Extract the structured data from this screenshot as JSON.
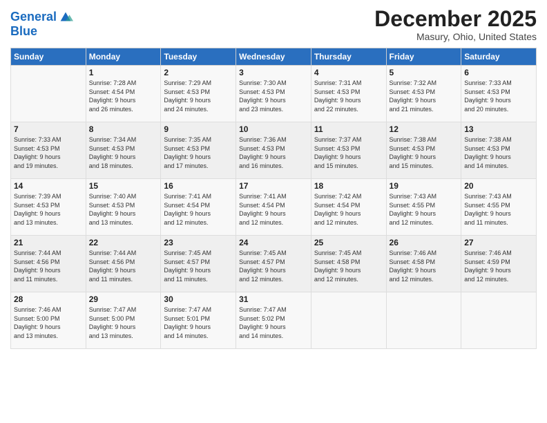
{
  "header": {
    "logo_line1": "General",
    "logo_line2": "Blue",
    "month_year": "December 2025",
    "location": "Masury, Ohio, United States"
  },
  "days_of_week": [
    "Sunday",
    "Monday",
    "Tuesday",
    "Wednesday",
    "Thursday",
    "Friday",
    "Saturday"
  ],
  "weeks": [
    [
      {
        "day": "",
        "info": ""
      },
      {
        "day": "1",
        "info": "Sunrise: 7:28 AM\nSunset: 4:54 PM\nDaylight: 9 hours\nand 26 minutes."
      },
      {
        "day": "2",
        "info": "Sunrise: 7:29 AM\nSunset: 4:53 PM\nDaylight: 9 hours\nand 24 minutes."
      },
      {
        "day": "3",
        "info": "Sunrise: 7:30 AM\nSunset: 4:53 PM\nDaylight: 9 hours\nand 23 minutes."
      },
      {
        "day": "4",
        "info": "Sunrise: 7:31 AM\nSunset: 4:53 PM\nDaylight: 9 hours\nand 22 minutes."
      },
      {
        "day": "5",
        "info": "Sunrise: 7:32 AM\nSunset: 4:53 PM\nDaylight: 9 hours\nand 21 minutes."
      },
      {
        "day": "6",
        "info": "Sunrise: 7:33 AM\nSunset: 4:53 PM\nDaylight: 9 hours\nand 20 minutes."
      }
    ],
    [
      {
        "day": "7",
        "info": "Sunrise: 7:33 AM\nSunset: 4:53 PM\nDaylight: 9 hours\nand 19 minutes."
      },
      {
        "day": "8",
        "info": "Sunrise: 7:34 AM\nSunset: 4:53 PM\nDaylight: 9 hours\nand 18 minutes."
      },
      {
        "day": "9",
        "info": "Sunrise: 7:35 AM\nSunset: 4:53 PM\nDaylight: 9 hours\nand 17 minutes."
      },
      {
        "day": "10",
        "info": "Sunrise: 7:36 AM\nSunset: 4:53 PM\nDaylight: 9 hours\nand 16 minutes."
      },
      {
        "day": "11",
        "info": "Sunrise: 7:37 AM\nSunset: 4:53 PM\nDaylight: 9 hours\nand 15 minutes."
      },
      {
        "day": "12",
        "info": "Sunrise: 7:38 AM\nSunset: 4:53 PM\nDaylight: 9 hours\nand 15 minutes."
      },
      {
        "day": "13",
        "info": "Sunrise: 7:38 AM\nSunset: 4:53 PM\nDaylight: 9 hours\nand 14 minutes."
      }
    ],
    [
      {
        "day": "14",
        "info": "Sunrise: 7:39 AM\nSunset: 4:53 PM\nDaylight: 9 hours\nand 13 minutes."
      },
      {
        "day": "15",
        "info": "Sunrise: 7:40 AM\nSunset: 4:53 PM\nDaylight: 9 hours\nand 13 minutes."
      },
      {
        "day": "16",
        "info": "Sunrise: 7:41 AM\nSunset: 4:54 PM\nDaylight: 9 hours\nand 12 minutes."
      },
      {
        "day": "17",
        "info": "Sunrise: 7:41 AM\nSunset: 4:54 PM\nDaylight: 9 hours\nand 12 minutes."
      },
      {
        "day": "18",
        "info": "Sunrise: 7:42 AM\nSunset: 4:54 PM\nDaylight: 9 hours\nand 12 minutes."
      },
      {
        "day": "19",
        "info": "Sunrise: 7:43 AM\nSunset: 4:55 PM\nDaylight: 9 hours\nand 12 minutes."
      },
      {
        "day": "20",
        "info": "Sunrise: 7:43 AM\nSunset: 4:55 PM\nDaylight: 9 hours\nand 11 minutes."
      }
    ],
    [
      {
        "day": "21",
        "info": "Sunrise: 7:44 AM\nSunset: 4:56 PM\nDaylight: 9 hours\nand 11 minutes."
      },
      {
        "day": "22",
        "info": "Sunrise: 7:44 AM\nSunset: 4:56 PM\nDaylight: 9 hours\nand 11 minutes."
      },
      {
        "day": "23",
        "info": "Sunrise: 7:45 AM\nSunset: 4:57 PM\nDaylight: 9 hours\nand 11 minutes."
      },
      {
        "day": "24",
        "info": "Sunrise: 7:45 AM\nSunset: 4:57 PM\nDaylight: 9 hours\nand 12 minutes."
      },
      {
        "day": "25",
        "info": "Sunrise: 7:45 AM\nSunset: 4:58 PM\nDaylight: 9 hours\nand 12 minutes."
      },
      {
        "day": "26",
        "info": "Sunrise: 7:46 AM\nSunset: 4:58 PM\nDaylight: 9 hours\nand 12 minutes."
      },
      {
        "day": "27",
        "info": "Sunrise: 7:46 AM\nSunset: 4:59 PM\nDaylight: 9 hours\nand 12 minutes."
      }
    ],
    [
      {
        "day": "28",
        "info": "Sunrise: 7:46 AM\nSunset: 5:00 PM\nDaylight: 9 hours\nand 13 minutes."
      },
      {
        "day": "29",
        "info": "Sunrise: 7:47 AM\nSunset: 5:00 PM\nDaylight: 9 hours\nand 13 minutes."
      },
      {
        "day": "30",
        "info": "Sunrise: 7:47 AM\nSunset: 5:01 PM\nDaylight: 9 hours\nand 14 minutes."
      },
      {
        "day": "31",
        "info": "Sunrise: 7:47 AM\nSunset: 5:02 PM\nDaylight: 9 hours\nand 14 minutes."
      },
      {
        "day": "",
        "info": ""
      },
      {
        "day": "",
        "info": ""
      },
      {
        "day": "",
        "info": ""
      }
    ]
  ]
}
